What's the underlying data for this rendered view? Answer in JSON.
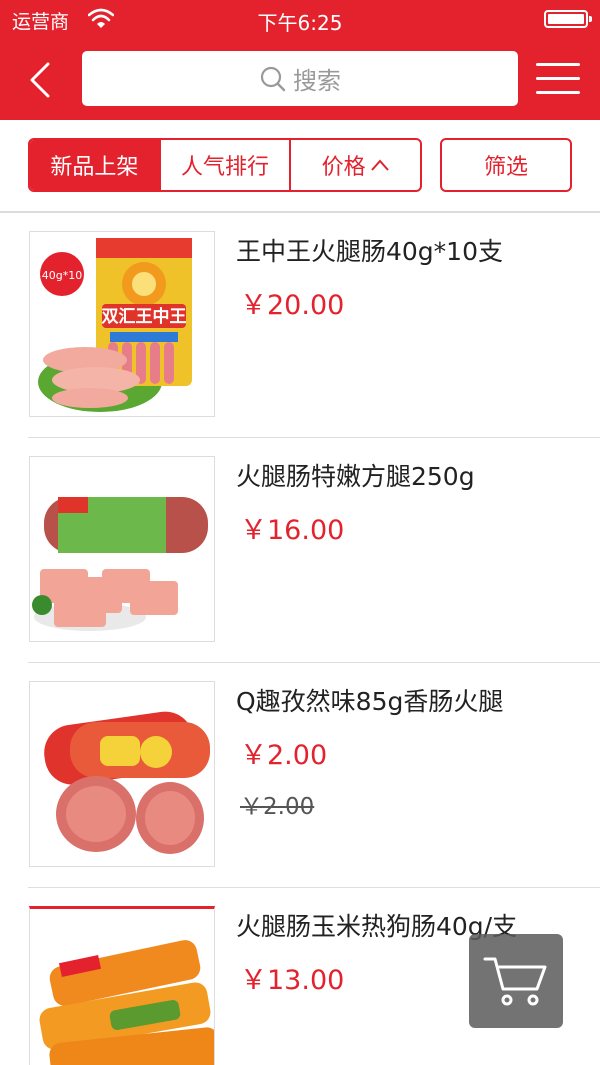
{
  "status_bar": {
    "carrier": "运营商",
    "time": "下午6:25"
  },
  "header": {
    "back_icon": "chevron-left-icon",
    "search_placeholder": "搜索",
    "menu_icon": "hamburger-icon"
  },
  "filters": {
    "tabs": [
      {
        "label": "新品上架",
        "active": true
      },
      {
        "label": "人气排行",
        "active": false
      },
      {
        "label": "价格",
        "caret": "^",
        "active": false
      }
    ],
    "screen_label": "筛选"
  },
  "products": [
    {
      "title": "王中王火腿肠40g*10支",
      "price": "￥20.00",
      "badge": "40g*10"
    },
    {
      "title": "火腿肠特嫩方腿250g",
      "price": "￥16.00"
    },
    {
      "title": "Q趣孜然味85g香肠火腿",
      "price": "￥2.00",
      "old_price": "￥2.00"
    },
    {
      "title": "火腿肠玉米热狗肠40g/支",
      "price": "￥13.00"
    }
  ],
  "colors": {
    "accent": "#e3222e",
    "cart_bg": "#5a5a5a"
  }
}
